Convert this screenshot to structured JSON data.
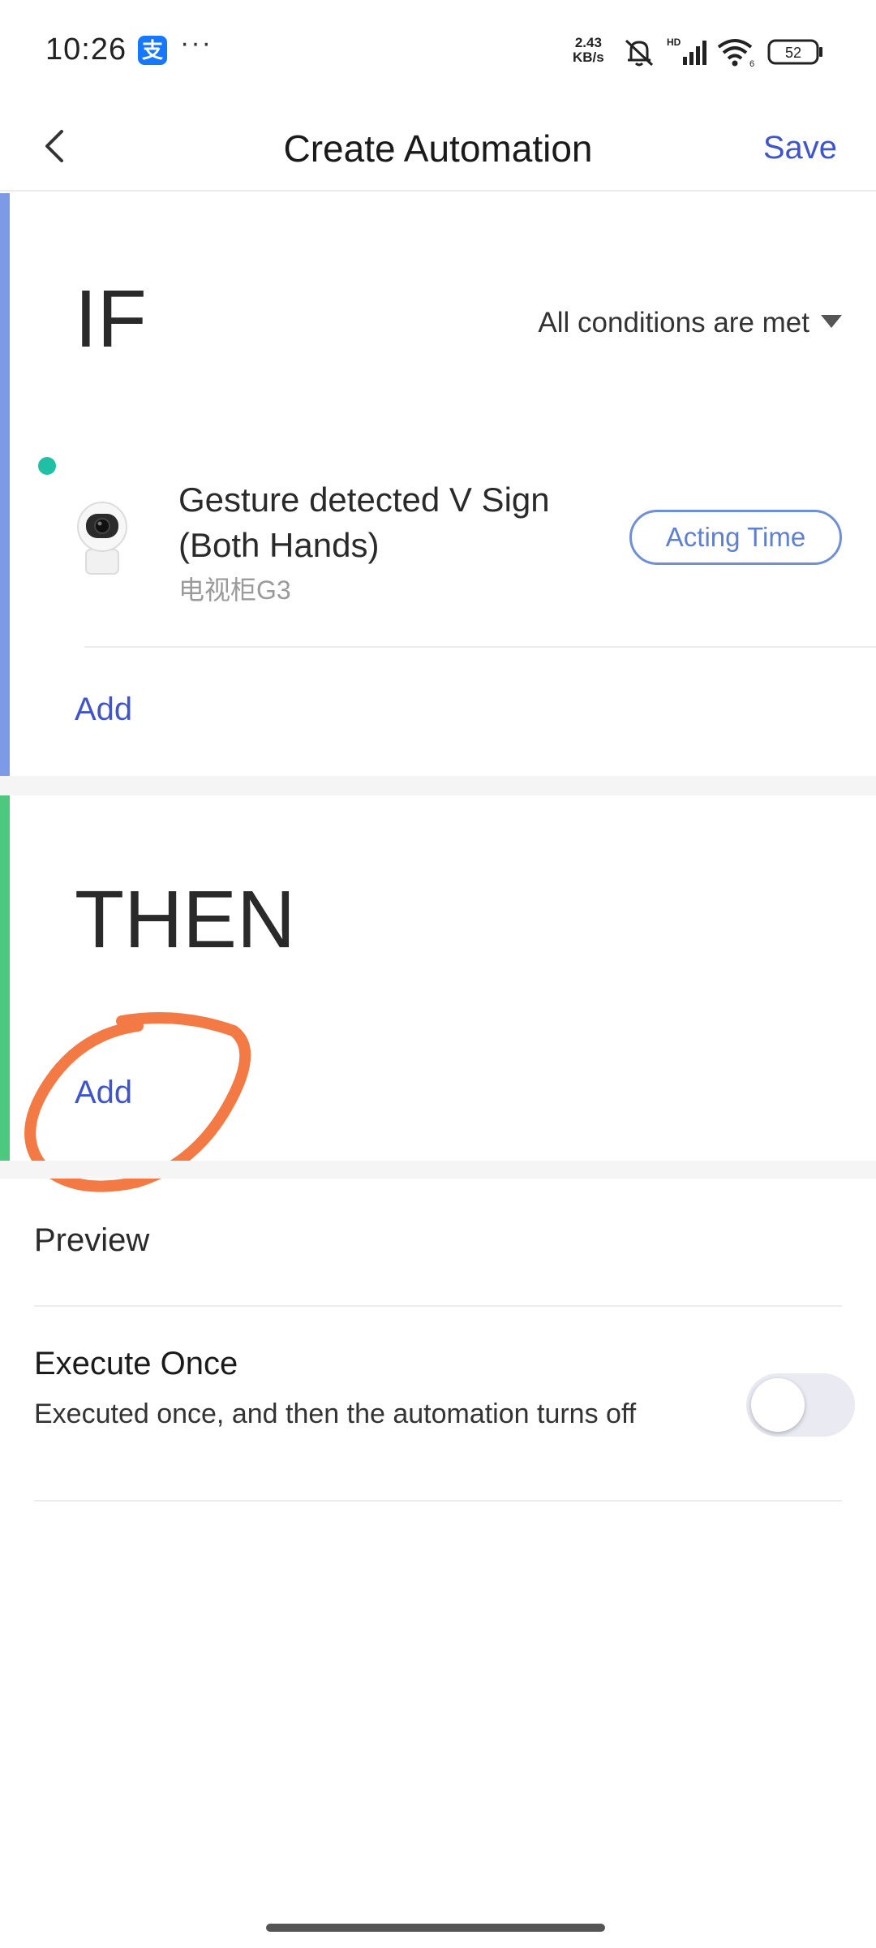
{
  "status_bar": {
    "time": "10:26",
    "alipay_glyph": "支",
    "more": "···",
    "net_speed_value": "2.43",
    "net_speed_unit": "KB/s",
    "signal_badge": "HD",
    "wifi_badge": "6",
    "battery": "52"
  },
  "header": {
    "title": "Create Automation",
    "save_label": "Save",
    "back_icon": "chevron-left-icon"
  },
  "if_section": {
    "title": "IF",
    "condition_mode": "All conditions are met",
    "accent_color": "#7c9ae6",
    "trigger": {
      "title": "Gesture detected V Sign (Both Hands)",
      "device": "电视柜G3",
      "status_color": "#1fc0a4",
      "acting_time_label": "Acting Time"
    },
    "add_label": "Add"
  },
  "then_section": {
    "title": "THEN",
    "accent_color": "#4cc97f",
    "add_label": "Add",
    "annotation_color": "#f47a45"
  },
  "options": {
    "preview_label": "Preview",
    "execute_once": {
      "title": "Execute Once",
      "description": "Executed once, and then the automation turns off",
      "enabled": false
    }
  },
  "colors": {
    "link": "#3f55c9",
    "outline_button": "#6f8fd6"
  }
}
